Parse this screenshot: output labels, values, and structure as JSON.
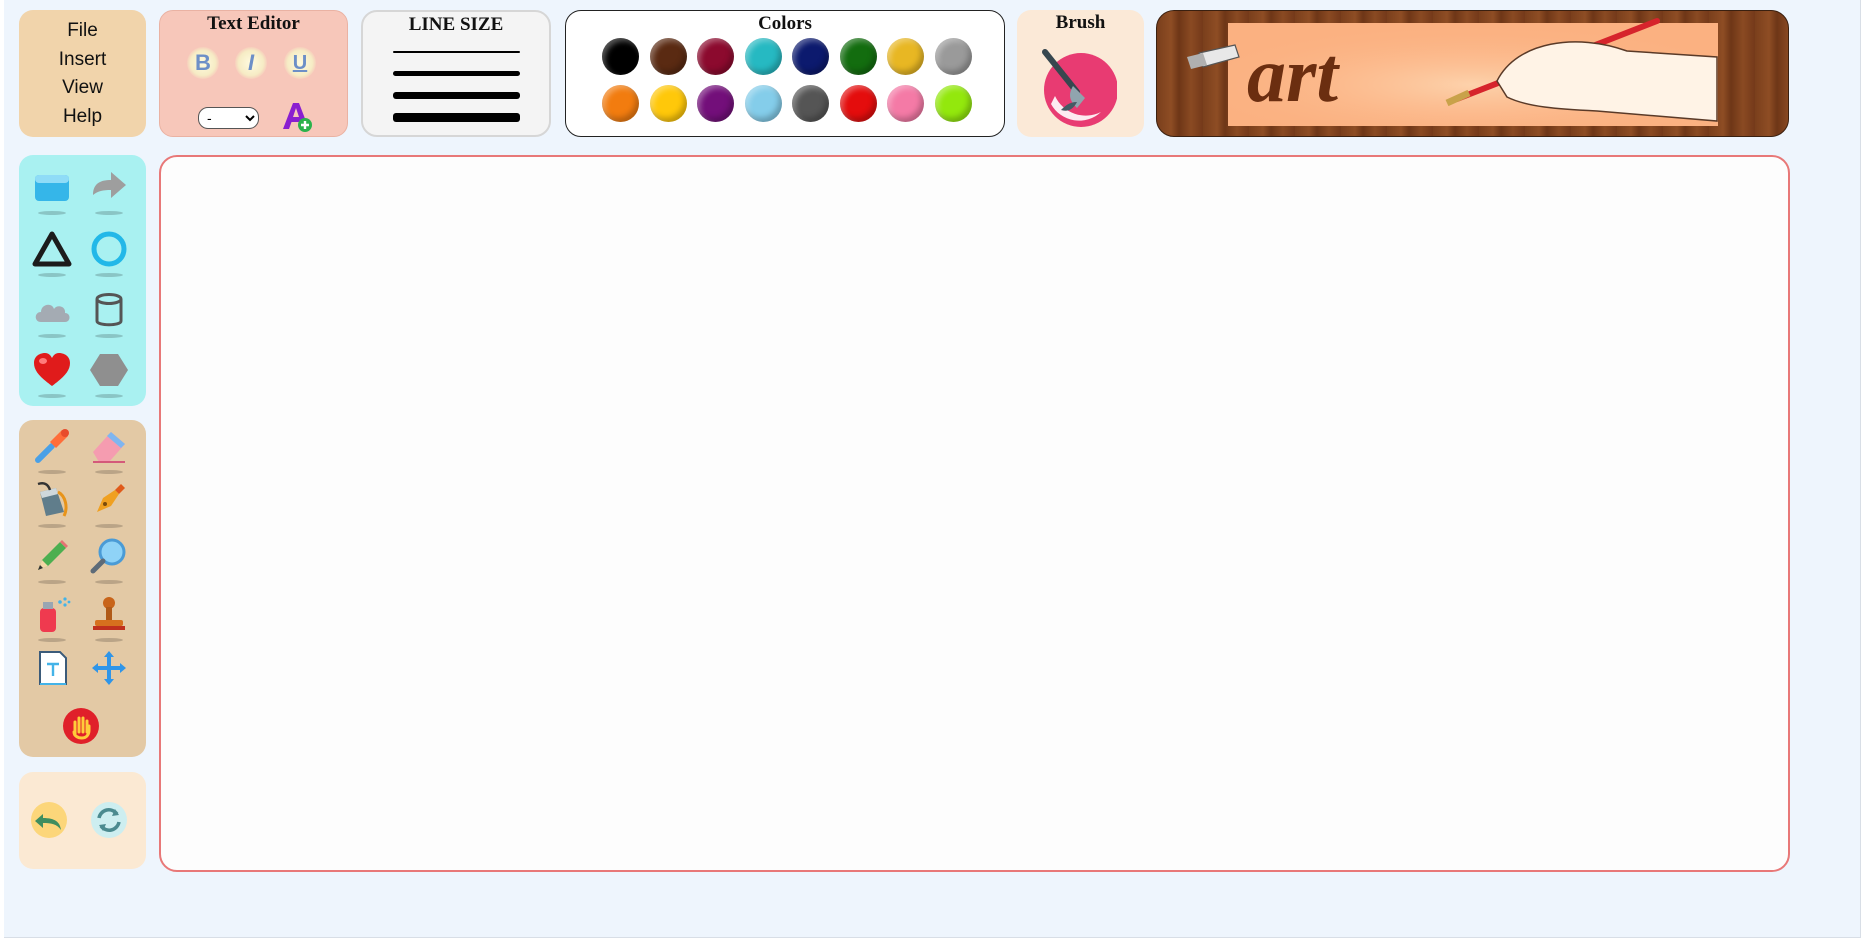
{
  "menu": {
    "items": [
      {
        "label": "File"
      },
      {
        "label": "Insert"
      },
      {
        "label": "View"
      },
      {
        "label": "Help"
      }
    ]
  },
  "text_editor": {
    "title": "Text Editor",
    "bold_label": "B",
    "italic_label": "I",
    "underline_label": "U",
    "font_select_value": "-",
    "font_color_icon": "font-color-add-icon"
  },
  "line_size": {
    "title": "LINE SIZE",
    "options": [
      "thin",
      "medium",
      "thick",
      "extra-thick"
    ]
  },
  "colors": {
    "title": "Colors",
    "row1": [
      "#000000",
      "#5a2a12",
      "#8c0a2e",
      "#26b9c2",
      "#0c1a6e",
      "#136d0f",
      "#e8b723",
      "#9a9a9a"
    ],
    "row2": [
      "#f27c0f",
      "#ffc80a",
      "#730f7a",
      "#84cdea",
      "#555555",
      "#e40d0d",
      "#f47aa6",
      "#93e80d"
    ]
  },
  "brush": {
    "title": "Brush",
    "icon": "paint-brush-icon"
  },
  "banner": {
    "text": "art"
  },
  "shapes": {
    "items": [
      "rectangle-icon",
      "arrow-icon",
      "triangle-icon",
      "circle-icon",
      "cloud-icon",
      "cylinder-icon",
      "heart-icon",
      "hexagon-icon"
    ]
  },
  "tools": {
    "items": [
      "color-picker-icon",
      "eraser-icon",
      "paint-bucket-icon",
      "pen-nib-icon",
      "pencil-icon",
      "magnifier-icon",
      "spray-can-icon",
      "stamp-icon",
      "text-box-icon",
      "move-icon",
      "stop-hand-icon"
    ]
  },
  "history": {
    "items": [
      "undo-icon",
      "refresh-icon"
    ]
  }
}
